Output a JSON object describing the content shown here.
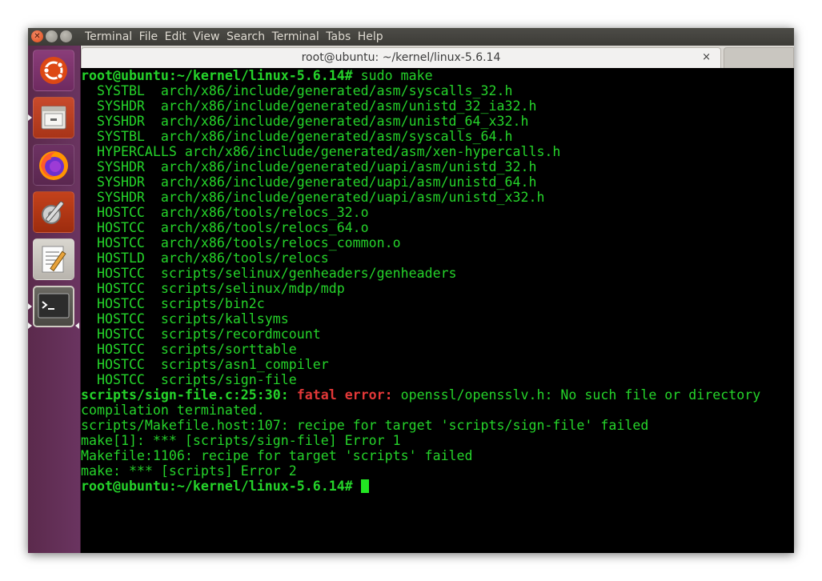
{
  "menu": {
    "close_glyph": "✕",
    "items": [
      "Terminal",
      "File",
      "Edit",
      "View",
      "Search",
      "Terminal",
      "Tabs",
      "Help"
    ]
  },
  "tab": {
    "title": "root@ubuntu: ~/kernel/linux-5.6.14",
    "close": "×"
  },
  "launcher": {
    "items": [
      "ubuntu-logo-icon",
      "files-icon",
      "firefox-icon",
      "system-settings-icon",
      "text-editor-icon",
      "terminal-icon"
    ]
  },
  "terminal": {
    "prompt": "root@ubuntu:~/kernel/linux-5.6.14#",
    "command": " sudo make",
    "build_lines": [
      "  SYSTBL  arch/x86/include/generated/asm/syscalls_32.h",
      "  SYSHDR  arch/x86/include/generated/asm/unistd_32_ia32.h",
      "  SYSHDR  arch/x86/include/generated/asm/unistd_64_x32.h",
      "  SYSTBL  arch/x86/include/generated/asm/syscalls_64.h",
      "  HYPERCALLS arch/x86/include/generated/asm/xen-hypercalls.h",
      "  SYSHDR  arch/x86/include/generated/uapi/asm/unistd_32.h",
      "  SYSHDR  arch/x86/include/generated/uapi/asm/unistd_64.h",
      "  SYSHDR  arch/x86/include/generated/uapi/asm/unistd_x32.h",
      "  HOSTCC  arch/x86/tools/relocs_32.o",
      "  HOSTCC  arch/x86/tools/relocs_64.o",
      "  HOSTCC  arch/x86/tools/relocs_common.o",
      "  HOSTLD  arch/x86/tools/relocs",
      "  HOSTCC  scripts/selinux/genheaders/genheaders",
      "  HOSTCC  scripts/selinux/mdp/mdp",
      "  HOSTCC  scripts/bin2c",
      "  HOSTCC  scripts/kallsyms",
      "  HOSTCC  scripts/recordmcount",
      "  HOSTCC  scripts/sorttable",
      "  HOSTCC  scripts/asn1_compiler",
      "  HOSTCC  scripts/sign-file"
    ],
    "error_location": "scripts/sign-file.c:25:30:",
    "error_label": "fatal error:",
    "error_message": " openssl/opensslv.h: No such file or directory",
    "after_lines": [
      "compilation terminated.",
      "scripts/Makefile.host:107: recipe for target 'scripts/sign-file' failed",
      "make[1]: *** [scripts/sign-file] Error 1",
      "Makefile:1106: recipe for target 'scripts' failed",
      "make: *** [scripts] Error 2"
    ],
    "final_prompt": "root@ubuntu:~/kernel/linux-5.6.14# "
  },
  "colors": {
    "terminal_text": "#25d32a",
    "terminal_bg": "#000000",
    "error_red": "#e23838",
    "launcher_bg": "#5e2750"
  }
}
